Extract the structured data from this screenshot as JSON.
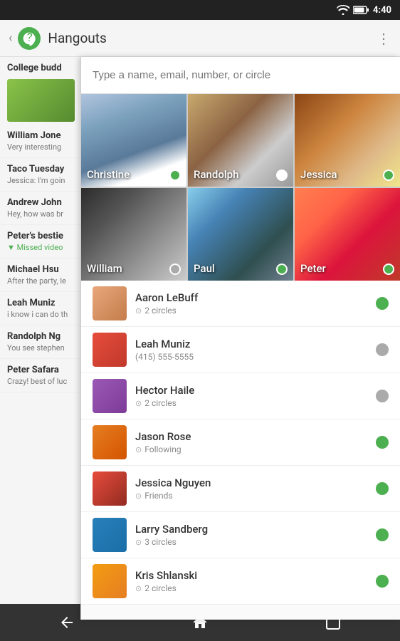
{
  "statusBar": {
    "time": "4:40",
    "wifiIcon": "wifi",
    "batteryIcon": "battery"
  },
  "appBar": {
    "title": "Hangouts",
    "menuIcon": "menu-dots"
  },
  "searchBar": {
    "placeholder": "Type a name, email, number, or circle"
  },
  "photoGrid": {
    "cells": [
      {
        "id": "christine",
        "name": "Christine",
        "status": "green"
      },
      {
        "id": "randolph",
        "name": "Randolph",
        "status": "white"
      },
      {
        "id": "jessica",
        "name": "Jessica",
        "status": "green"
      },
      {
        "id": "william",
        "name": "William",
        "status": "gray"
      },
      {
        "id": "paul",
        "name": "Paul",
        "status": "green"
      },
      {
        "id": "peter",
        "name": "Peter",
        "status": "green"
      }
    ]
  },
  "contacts": [
    {
      "id": "aaron",
      "name": "Aaron LeBuff",
      "sub": "2 circles",
      "subType": "circles",
      "status": "green"
    },
    {
      "id": "leah",
      "name": "Leah Muniz",
      "sub": "(415) 555-5555",
      "subType": "phone",
      "status": "gray"
    },
    {
      "id": "hector",
      "name": "Hector Haile",
      "sub": "2 circles",
      "subType": "circles",
      "status": "gray"
    },
    {
      "id": "jason",
      "name": "Jason Rose",
      "sub": "Following",
      "subType": "following",
      "status": "green"
    },
    {
      "id": "jessica",
      "name": "Jessica Nguyen",
      "sub": "Friends",
      "subType": "circles",
      "status": "green"
    },
    {
      "id": "larry",
      "name": "Larry Sandberg",
      "sub": "3 circles",
      "subType": "circles",
      "status": "green"
    },
    {
      "id": "kris",
      "name": "Kris Shlanski",
      "sub": "2 circles",
      "subType": "circles",
      "status": "green"
    }
  ],
  "leftPanel": {
    "sectionHeader": "College budd",
    "chats": [
      {
        "name": "William Jone",
        "preview": "Very interesting"
      },
      {
        "name": "Taco Tuesday",
        "preview": "Jessica: I'm goin"
      },
      {
        "name": "Andrew John",
        "preview": "Hey, how was br"
      },
      {
        "name": "Peter's bestie",
        "missed": "Missed video"
      },
      {
        "name": "Michael Hsu",
        "preview": "After the party, le"
      },
      {
        "name": "Leah Muniz",
        "preview": "i know i can do th"
      },
      {
        "name": "Randolph Ng",
        "preview": "You see stephen"
      },
      {
        "name": "Peter Safara",
        "preview": "Crazy! best of luc"
      }
    ]
  },
  "navBar": {
    "backIcon": "◁",
    "homeIcon": "⌂",
    "recentIcon": "▭"
  }
}
